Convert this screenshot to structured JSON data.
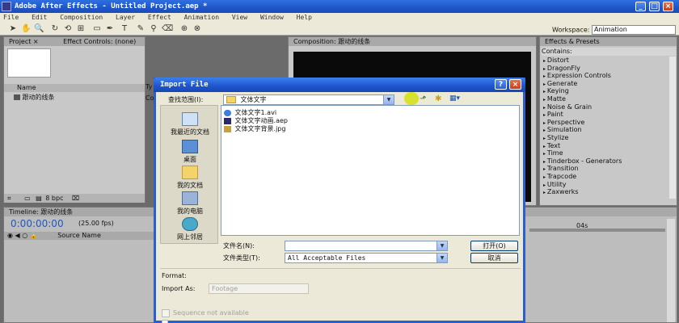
{
  "app": {
    "title": "Adobe After Effects - Untitled Project.aep *",
    "menu": [
      "File",
      "Edit",
      "Composition",
      "Layer",
      "Effect",
      "Animation",
      "View",
      "Window",
      "Help"
    ],
    "workspace_label": "Workspace:",
    "workspace_value": "Animation"
  },
  "project_panel": {
    "tab_project": "Project",
    "tab_effect_controls": "Effect Controls: (none)",
    "col_name": "Name",
    "col_type": "Ty",
    "item_name": "跟动的线条",
    "item_type": "Co",
    "bpc": "8 bpc"
  },
  "composition_panel": {
    "tab": "Composition: 跟动的线条"
  },
  "effects_panel": {
    "tab": "Effects & Presets",
    "contains_label": "Contains:",
    "categories": [
      "Distort",
      "DragonFly",
      "Expression Controls",
      "Generate",
      "Keying",
      "Matte",
      "Noise & Grain",
      "Paint",
      "Perspective",
      "Simulation",
      "Stylize",
      "Text",
      "Time",
      "Tinderbox - Generators",
      "Transition",
      "Trapcode",
      "Utility",
      "Zaxwerks"
    ]
  },
  "timeline": {
    "tab": "Timeline: 跟动的线条",
    "timecode": "0:00:00:00",
    "fps": "(25.00 fps)",
    "col_source": "Source Name",
    "ruler_mark": "04s"
  },
  "dialog": {
    "title": "Import File",
    "look_in_label": "查找范围(I):",
    "look_in_value": "文体文字",
    "places": [
      "我最近的文档",
      "桌面",
      "我的文档",
      "我的电脑",
      "网上邻居"
    ],
    "files": [
      "文体文字1.avi",
      "文体文字动画.aep",
      "文体文字背景.jpg"
    ],
    "filename_label": "文件名(N):",
    "filename_value": "",
    "filetype_label": "文件类型(T):",
    "filetype_value": "All Acceptable Files",
    "open_button": "打开(O)",
    "cancel_button": "取消",
    "format_label": "Format:",
    "import_as_label": "Import As:",
    "import_as_value": "Footage",
    "sequence_label": "Sequence not available"
  }
}
